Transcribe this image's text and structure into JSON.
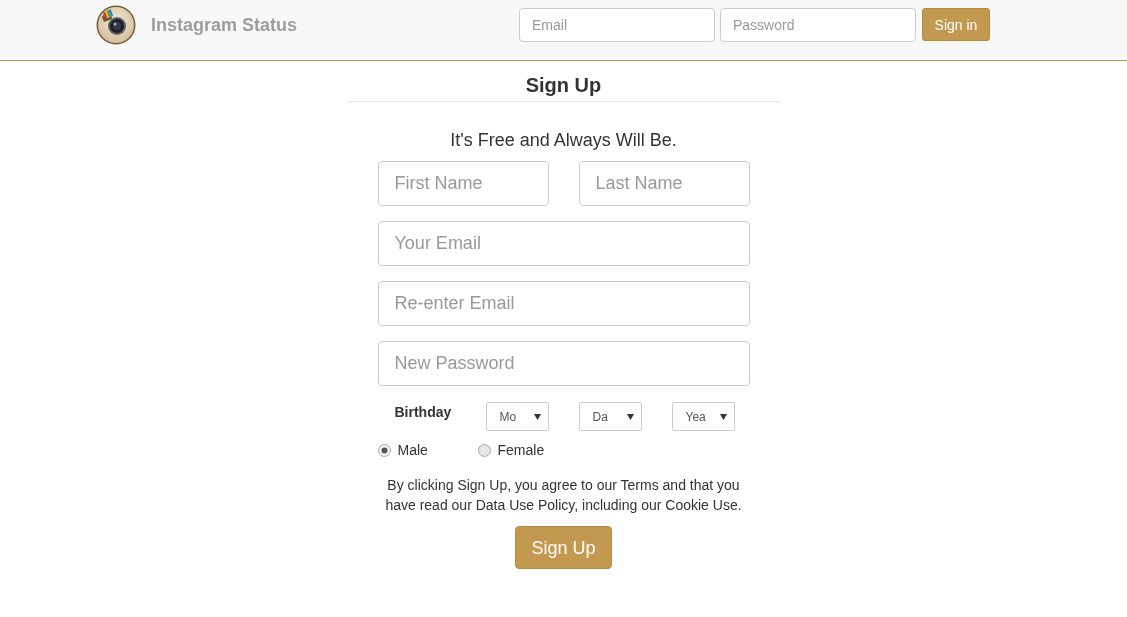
{
  "header": {
    "brand": "Instagram Status",
    "login_form": {
      "fields": [
        {
          "placeholder": "Email"
        },
        {
          "placeholder": "Password"
        }
      ],
      "button": "Sign in"
    }
  },
  "signup": {
    "title": "Sign Up",
    "tagline": "It's Free and Always Will Be.",
    "field_rows": [
      {
        "fields": [
          {
            "placeholder": "First Name"
          },
          {
            "placeholder": "Last Name"
          }
        ]
      },
      {
        "fields": [
          {
            "placeholder": "Your Email"
          }
        ]
      },
      {
        "fields": [
          {
            "placeholder": "Re-enter Email"
          }
        ]
      },
      {
        "fields": [
          {
            "placeholder": "New Password"
          }
        ]
      }
    ],
    "birthday": {
      "label": "Birthday",
      "selects": [
        {
          "value": "Mo"
        },
        {
          "value": "Da"
        },
        {
          "value": "Yea"
        }
      ]
    },
    "gender": [
      {
        "label": "Male",
        "selected": true
      },
      {
        "label": "Female",
        "selected": false
      }
    ],
    "terms": "By clicking Sign Up, you agree to our Terms and that you have read our Data Use Policy, including our Cookie Use.",
    "button": "Sign Up"
  }
}
